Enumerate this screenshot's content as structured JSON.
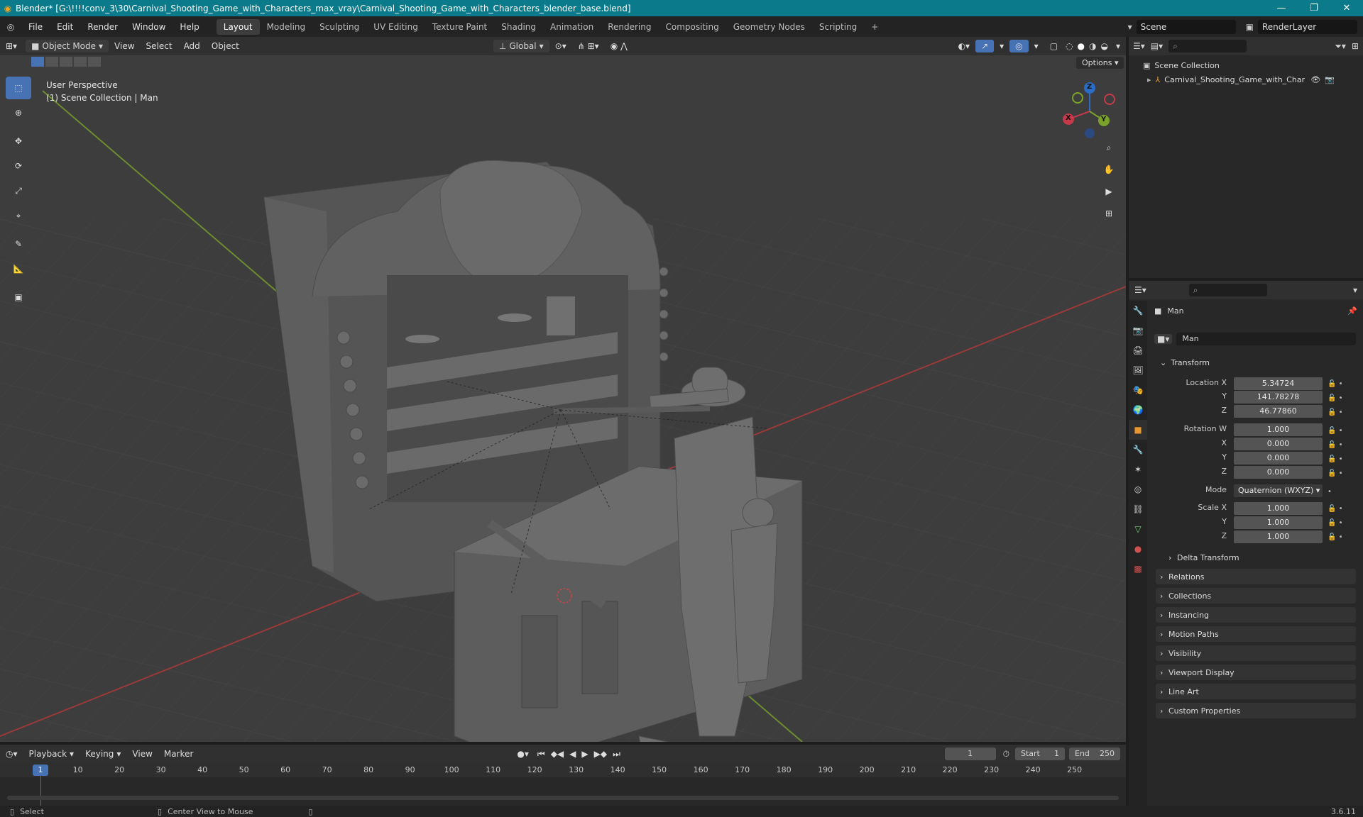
{
  "window": {
    "title": "Blender* [G:\\!!!!conv_3\\30\\Carnival_Shooting_Game_with_Characters_max_vray\\Carnival_Shooting_Game_with_Characters_blender_base.blend]",
    "minimize": "—",
    "maximize": "❐",
    "close": "✕"
  },
  "menu": [
    "File",
    "Edit",
    "Render",
    "Window",
    "Help"
  ],
  "workspaces": [
    "Layout",
    "Modeling",
    "Sculpting",
    "UV Editing",
    "Texture Paint",
    "Shading",
    "Animation",
    "Rendering",
    "Compositing",
    "Geometry Nodes",
    "Scripting"
  ],
  "active_workspace": "Layout",
  "scene": {
    "name": "Scene",
    "render_layer": "RenderLayer"
  },
  "viewport_header": {
    "mode": "Object Mode",
    "menus": [
      "View",
      "Select",
      "Add",
      "Object"
    ],
    "orientation": "Global",
    "options": "Options"
  },
  "viewport": {
    "perspective": "User Perspective",
    "collection_info": "(1) Scene Collection | Man",
    "gizmo": {
      "x": "X",
      "y": "Y",
      "z": "Z"
    }
  },
  "outliner": {
    "root": "Scene Collection",
    "items": [
      {
        "label": "Carnival_Shooting_Game_with_Characters"
      }
    ]
  },
  "properties": {
    "object_name": "Man",
    "data_name": "Man",
    "transform_label": "Transform",
    "location": {
      "label": "Location X",
      "x": "5.34724",
      "y": "141.78278",
      "z": "46.77860"
    },
    "rotation": {
      "label": "Rotation W",
      "w": "1.000",
      "x": "0.000",
      "y": "0.000",
      "z": "0.000"
    },
    "mode": {
      "label": "Mode",
      "value": "Quaternion (WXYZ)"
    },
    "scale": {
      "label": "Scale X",
      "x": "1.000",
      "y": "1.000",
      "z": "1.000"
    },
    "axis_labels": {
      "y": "Y",
      "z": "Z",
      "x": "X"
    },
    "delta_transform": "Delta Transform",
    "panels": [
      "Relations",
      "Collections",
      "Instancing",
      "Motion Paths",
      "Visibility",
      "Viewport Display",
      "Line Art",
      "Custom Properties"
    ]
  },
  "timeline": {
    "menus": [
      "Playback",
      "Keying",
      "View",
      "Marker"
    ],
    "current_frame": "1",
    "start_label": "Start",
    "start": "1",
    "end_label": "End",
    "end": "250",
    "ticks": [
      "1",
      "10",
      "20",
      "30",
      "40",
      "50",
      "60",
      "70",
      "80",
      "90",
      "100",
      "110",
      "120",
      "130",
      "140",
      "150",
      "160",
      "170",
      "180",
      "190",
      "200",
      "210",
      "220",
      "230",
      "240",
      "250"
    ]
  },
  "statusbar": {
    "select": "Select",
    "center": "Center View to Mouse",
    "version": "3.6.11"
  }
}
